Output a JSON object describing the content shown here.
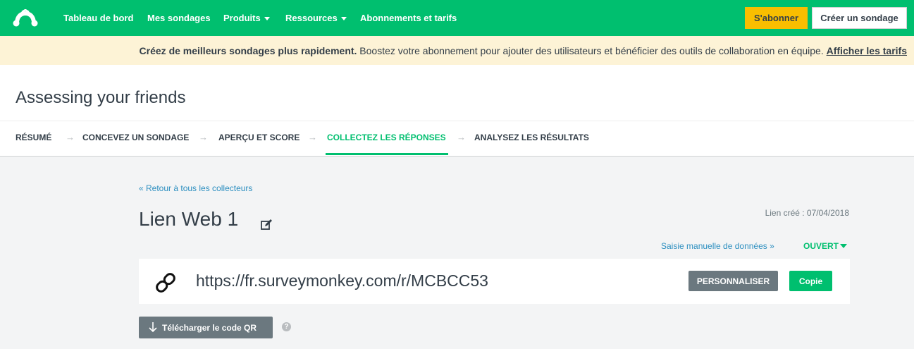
{
  "nav": {
    "items": [
      {
        "label": "Tableau de bord",
        "dropdown": false
      },
      {
        "label": "Mes sondages",
        "dropdown": false
      },
      {
        "label": "Produits",
        "dropdown": true
      },
      {
        "label": "Ressources",
        "dropdown": true
      },
      {
        "label": "Abonnements et tarifs",
        "dropdown": false
      }
    ],
    "subscribe_label": "S'abonner",
    "create_label": "Créer un sondage"
  },
  "banner": {
    "bold_text": "Créez de meilleurs sondages plus rapidement.",
    "text": " Boostez votre abonnement pour ajouter des utilisateurs et bénéficier des outils de collaboration en équipe. ",
    "link": "Afficher les tarifs"
  },
  "survey": {
    "title": "Assessing your friends"
  },
  "steps": [
    {
      "label": "RÉSUMÉ",
      "active": false
    },
    {
      "label": "CONCEVEZ UN SONDAGE",
      "active": false
    },
    {
      "label": "APERÇU ET SCORE",
      "active": false
    },
    {
      "label": "COLLECTEZ LES RÉPONSES",
      "active": true
    },
    {
      "label": "ANALYSEZ LES RÉSULTATS",
      "active": false
    }
  ],
  "collector": {
    "back_link": "« Retour à tous les collecteurs",
    "name": "Lien Web 1",
    "created": "Lien créé : 07/04/2018",
    "manual_entry": "Saisie manuelle de données »",
    "status": "OUVERT",
    "url": "https://fr.surveymonkey.com/r/MCBCC53",
    "customize_label": "PERSONNALISER",
    "copy_label": "Copie",
    "qr_label": "Télécharger le code QR",
    "help_glyph": "?"
  },
  "colors": {
    "brand_green": "#00bf6f",
    "subscribe_yellow": "#f9be00",
    "banner_bg": "#fdf3d6",
    "link_blue": "#2d8fc0",
    "button_gray": "#6b787f"
  },
  "icons": [
    "surveymonkey-logo-icon",
    "chevron-down-icon",
    "arrow-right-icon",
    "edit-icon",
    "caret-down-icon",
    "link-icon",
    "download-arrow-icon",
    "help-icon"
  ]
}
